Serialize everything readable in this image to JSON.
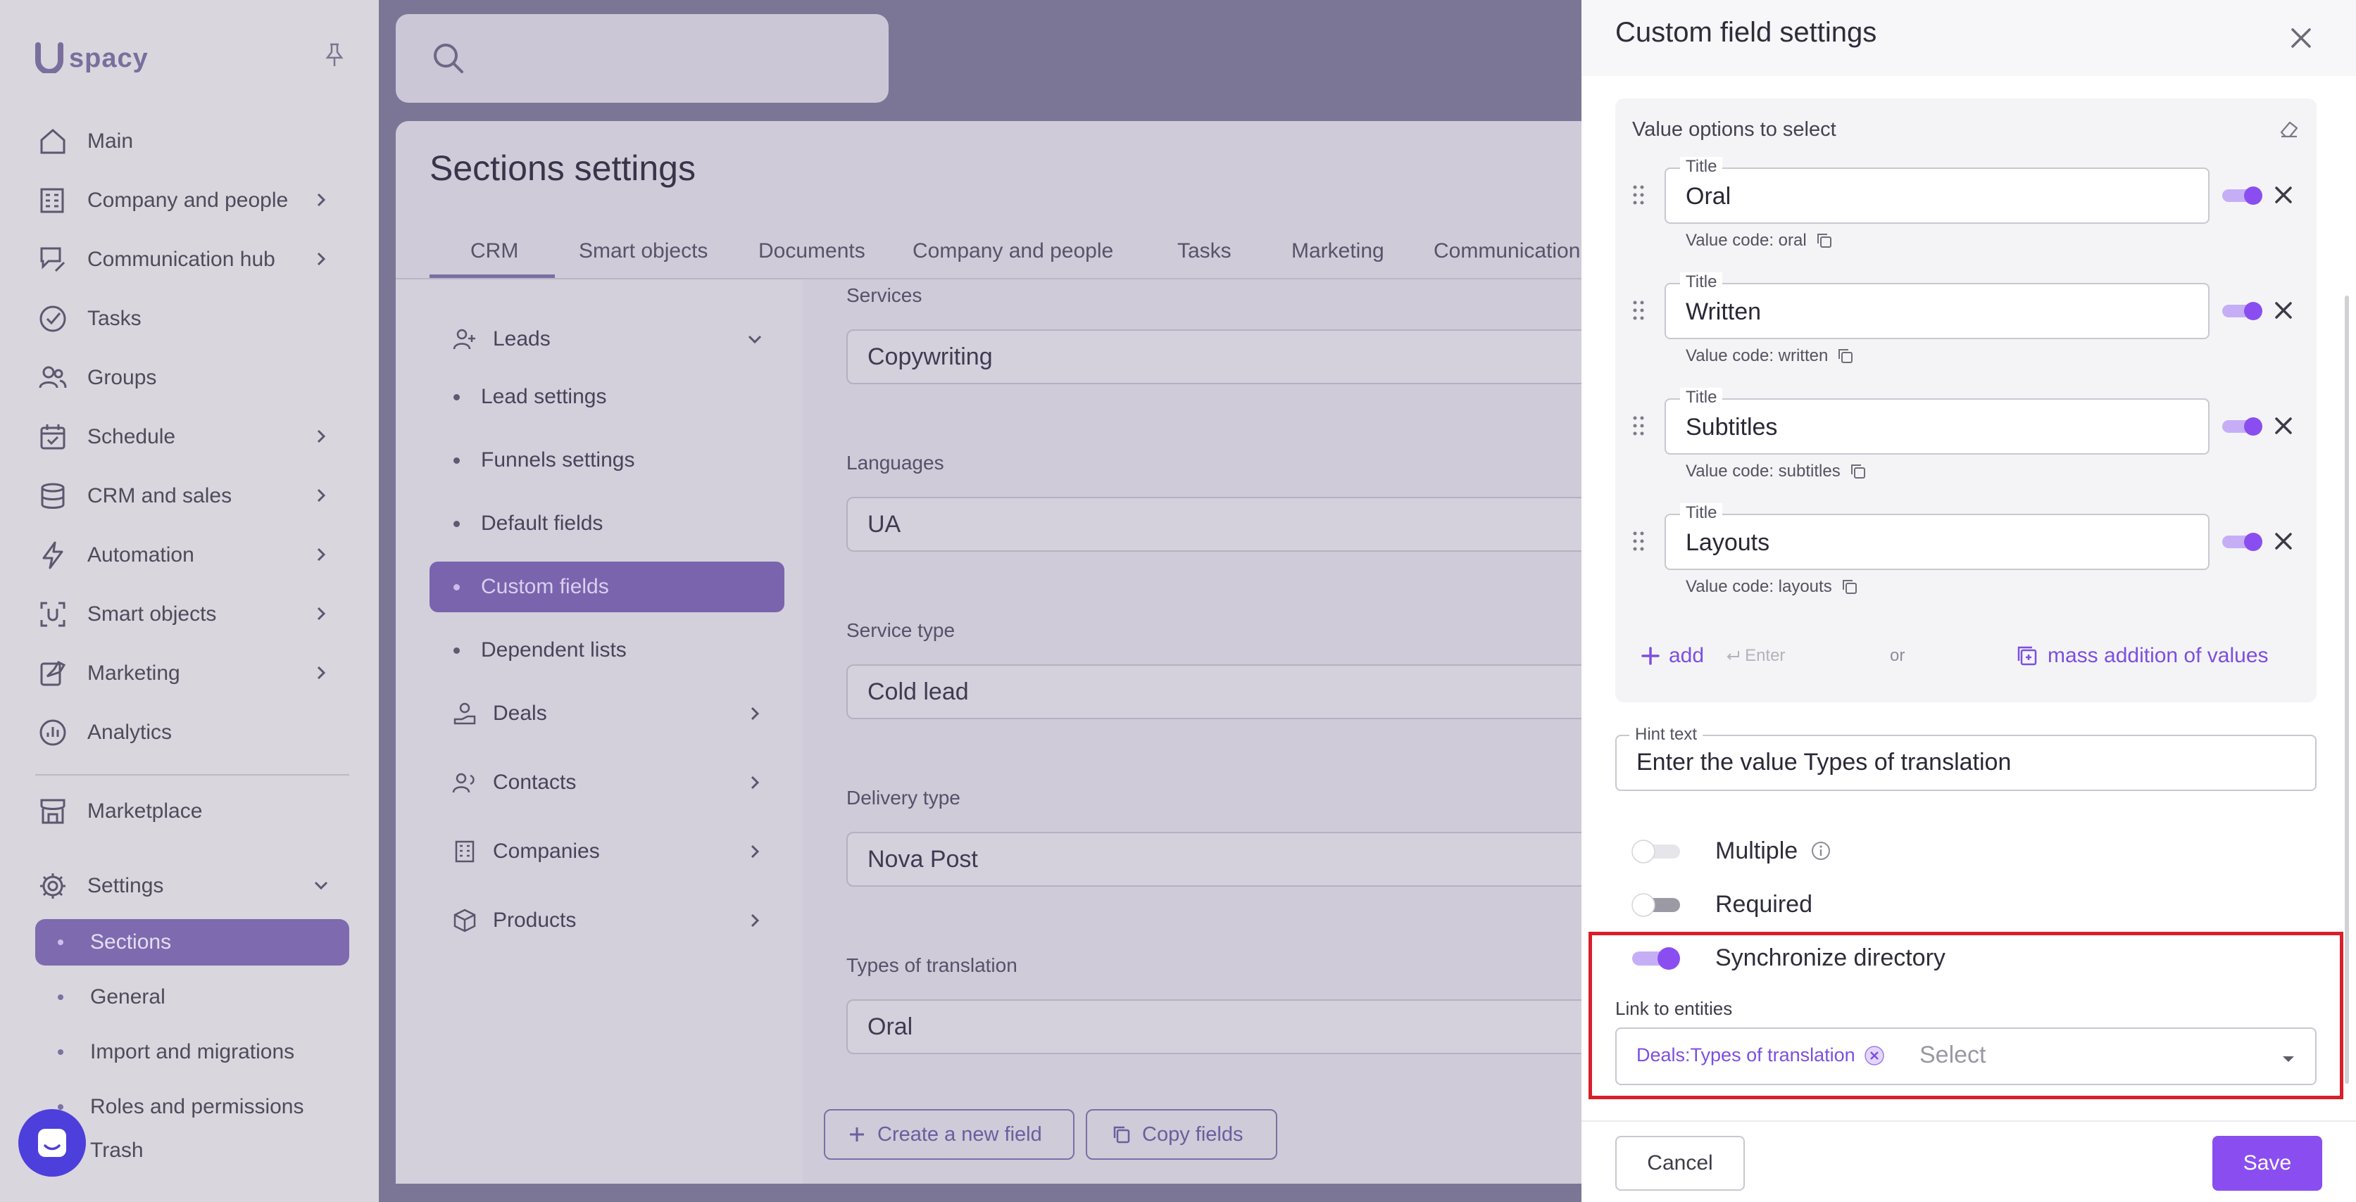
{
  "brand": {
    "name": "spacy"
  },
  "sidebar": {
    "items": [
      {
        "label": "Main",
        "icon": "home-icon"
      },
      {
        "label": "Company and people",
        "icon": "building-icon"
      },
      {
        "label": "Communication hub",
        "icon": "chat-edit-icon"
      },
      {
        "label": "Tasks",
        "icon": "check-circle-icon"
      },
      {
        "label": "Groups",
        "icon": "users-icon"
      },
      {
        "label": "Schedule",
        "icon": "calendar-icon"
      },
      {
        "label": "CRM and sales",
        "icon": "database-icon"
      },
      {
        "label": "Automation",
        "icon": "lightning-icon"
      },
      {
        "label": "Smart objects",
        "icon": "scan-icon"
      },
      {
        "label": "Marketing",
        "icon": "megaphone-icon"
      },
      {
        "label": "Analytics",
        "icon": "chart-icon"
      },
      {
        "label": "Marketplace",
        "icon": "store-icon"
      },
      {
        "label": "Settings",
        "icon": "gear-icon"
      }
    ],
    "settings_sub": [
      "Sections",
      "General",
      "Import and migrations",
      "Roles and permissions",
      "Trash"
    ]
  },
  "main": {
    "title": "Sections settings",
    "tabs": [
      "CRM",
      "Smart objects",
      "Documents",
      "Company and people",
      "Tasks",
      "Marketing",
      "Communication"
    ],
    "left_menu": {
      "leads": "Leads",
      "lead_subs": [
        "Lead settings",
        "Funnels settings",
        "Default fields",
        "Custom fields",
        "Dependent lists"
      ],
      "groups": [
        "Deals",
        "Contacts",
        "Companies",
        "Products"
      ]
    },
    "fields": [
      {
        "label": "Services",
        "value": "Copywriting"
      },
      {
        "label": "Languages",
        "value": "UA"
      },
      {
        "label": "Service type",
        "value": "Cold lead"
      },
      {
        "label": "Delivery type",
        "value": "Nova Post"
      },
      {
        "label": "Types of translation",
        "value": "Oral"
      }
    ],
    "create_field": "Create a new field",
    "copy_fields": "Copy fields"
  },
  "panel": {
    "title": "Custom field settings",
    "options_label": "Value options to select",
    "title_label": "Title",
    "options": [
      {
        "title": "Oral",
        "code": "Value code: oral",
        "enabled": true
      },
      {
        "title": "Written",
        "code": "Value code: written",
        "enabled": true
      },
      {
        "title": "Subtitles",
        "code": "Value code: subtitles",
        "enabled": true
      },
      {
        "title": "Layouts",
        "code": "Value code: layouts",
        "enabled": true
      }
    ],
    "add_label": "add",
    "enter_hint": "Enter",
    "or": "or",
    "mass_add": "mass addition of values",
    "hint_label": "Hint text",
    "hint_value": "Enter the value Types of translation",
    "multiple_label": "Multiple",
    "required_label": "Required",
    "sync_label": "Synchronize directory",
    "entities_label": "Link to entities",
    "entities_chip": "Deals:Types of translation",
    "entities_placeholder": "Select",
    "cancel": "Cancel",
    "save": "Save"
  },
  "colors": {
    "accent": "#8a4ef0",
    "highlight": "#d81f2a"
  }
}
